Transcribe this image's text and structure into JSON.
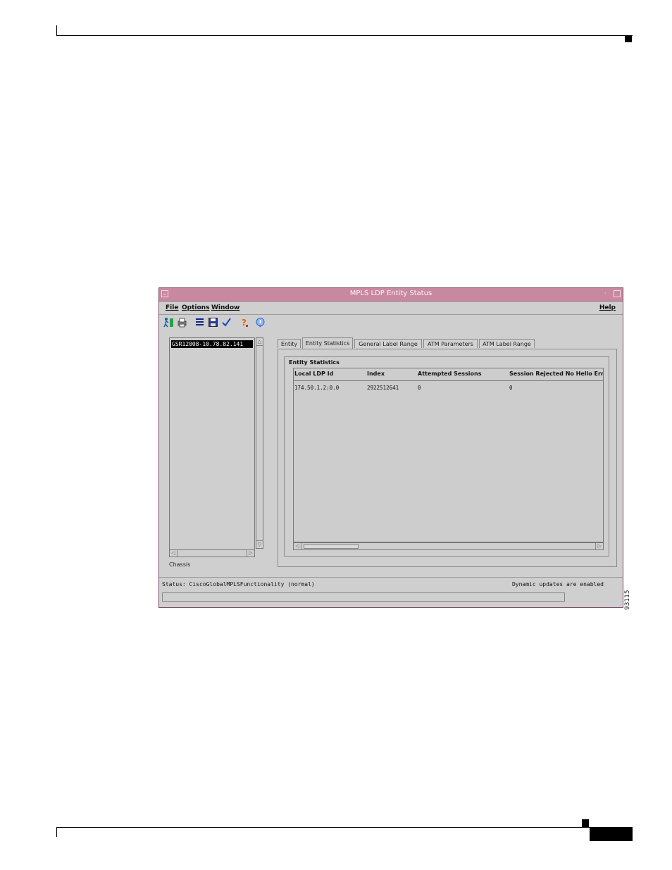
{
  "window": {
    "title": "MPLS LDP Entity Status"
  },
  "menu": {
    "file": "File",
    "options": "Options",
    "window": "Window",
    "help": "Help"
  },
  "toolbar": {
    "icons": [
      "run-icon",
      "print-icon",
      "list-icon",
      "save-icon",
      "check-icon",
      "help-icon",
      "info-icon"
    ]
  },
  "tree": {
    "selected_node": "GSR12008-10.78.82.141",
    "footer_label": "Chassis"
  },
  "tabs": [
    {
      "label": "Entity"
    },
    {
      "label": "Entity Statistics"
    },
    {
      "label": "General Label Range"
    },
    {
      "label": "ATM Parameters"
    },
    {
      "label": "ATM Label Range"
    }
  ],
  "active_tab": "Entity Statistics",
  "entity_statistics": {
    "group_title": "Entity Statistics",
    "columns": [
      "Local LDP Id",
      "Index",
      "Attempted Sessions",
      "Session Rejected No Hello Erro"
    ],
    "rows": [
      [
        "174.50.1.2:0.0",
        "2922512641",
        "0",
        "0"
      ]
    ]
  },
  "status": {
    "text": "Status: CiscoGlobalMPLSFunctionality (normal)",
    "dynamic": "Dynamic updates are enabled"
  },
  "figure_id": "93115",
  "colors": {
    "titlebar": "#c8889f",
    "window_bg": "#cfcfcf",
    "selection": "#000000"
  }
}
